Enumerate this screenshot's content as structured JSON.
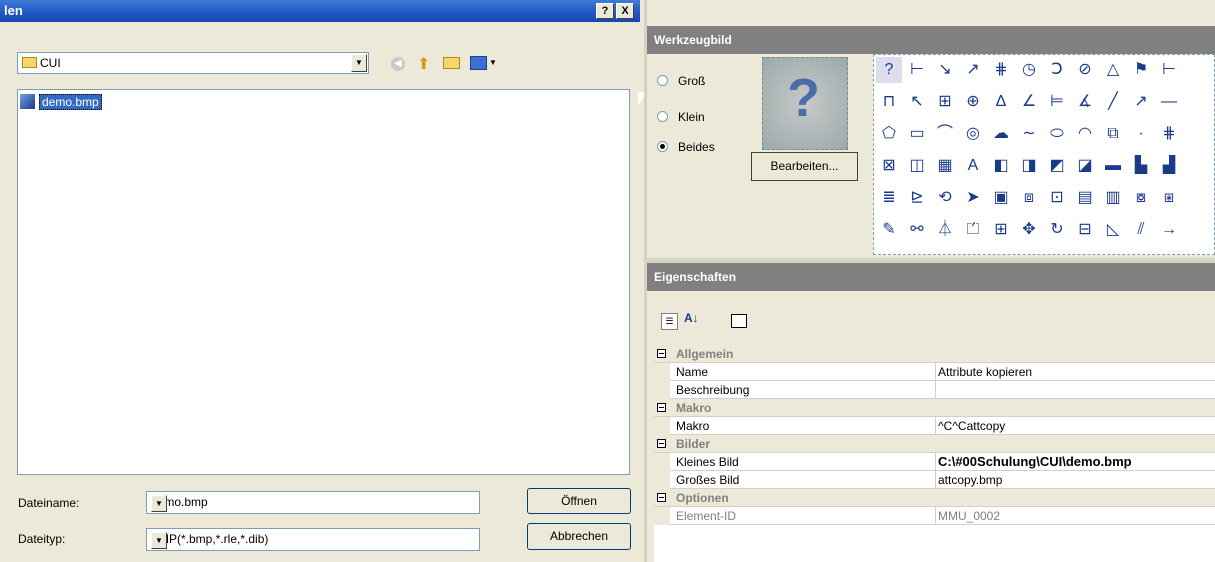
{
  "dialog": {
    "title": "len",
    "help_btn": "?",
    "close_btn": "X",
    "lookin_value": "CUI",
    "files": [
      {
        "name": "demo.bmp"
      }
    ],
    "filename_label": "Dateiname:",
    "filename_value": "demo.bmp",
    "filetype_label": "Dateityp:",
    "filetype_value": "BMP(*.bmp,*.rle,*.dib)",
    "open_btn": "Öffnen",
    "cancel_btn": "Abbrechen"
  },
  "toolbar_image": {
    "header": "Werkzeugbild",
    "radio_large": "Groß",
    "radio_small": "Klein",
    "radio_both": "Beides",
    "selected": "Beides",
    "edit_btn": "Bearbeiten..."
  },
  "properties": {
    "header": "Eigenschaften",
    "categories": [
      {
        "name": "Allgemein",
        "rows": [
          {
            "key": "Name",
            "value": "Attribute kopieren"
          },
          {
            "key": "Beschreibung",
            "value": ""
          }
        ]
      },
      {
        "name": "Makro",
        "rows": [
          {
            "key": "Makro",
            "value": "^C^Cattcopy"
          }
        ]
      },
      {
        "name": "Bilder",
        "rows": [
          {
            "key": "Kleines Bild",
            "value": "C:\\#00Schulung\\CUI\\demo.bmp"
          },
          {
            "key": "Großes Bild",
            "value": "attcopy.bmp"
          }
        ]
      },
      {
        "name": "Optionen",
        "rows": [
          {
            "key": "Element-ID",
            "value": "MMU_0002"
          }
        ]
      }
    ]
  }
}
